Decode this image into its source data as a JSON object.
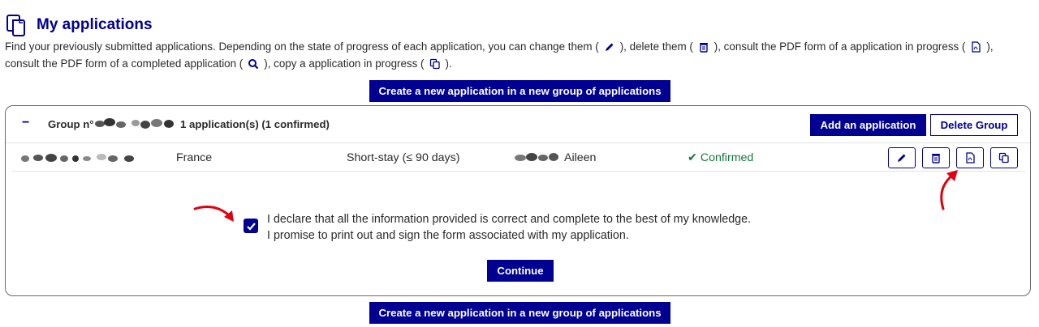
{
  "header": {
    "title": "My applications",
    "icon": "copy-documents-icon"
  },
  "intro": {
    "part1": "Find your previously submitted applications. Depending on the state of progress of each application, you can change them (",
    "part2": "), delete them (",
    "part3": "), consult the PDF form of a application in progress (",
    "part4": "), consult the PDF form of a completed application (",
    "part5": "), copy a application in progress (",
    "part6": ")."
  },
  "actions": {
    "create_new_group": "Create a new application in a new group of applications"
  },
  "group": {
    "collapse_symbol": "−",
    "label": "Group n°",
    "count_text": "1 application(s) (1 confirmed)",
    "add_application": "Add an application",
    "delete_group": "Delete Group"
  },
  "application": {
    "country": "France",
    "visa_type": "Short-stay (≤ 90 days)",
    "first_name": "Aileen",
    "status_mark": "✔",
    "status": "Confirmed",
    "row_actions": [
      "edit-pencil-icon",
      "delete-trash-icon",
      "pdf-form-icon",
      "copy-application-icon"
    ]
  },
  "declaration": {
    "checked": true,
    "line1": "I declare that all the information provided is correct and complete to the best of my knowledge.",
    "line2": "I promise to print out and sign the form associated with my application."
  },
  "continue_label": "Continue",
  "colors": {
    "primary": "#000091",
    "success": "#18753c",
    "annotation": "#e1000f"
  }
}
